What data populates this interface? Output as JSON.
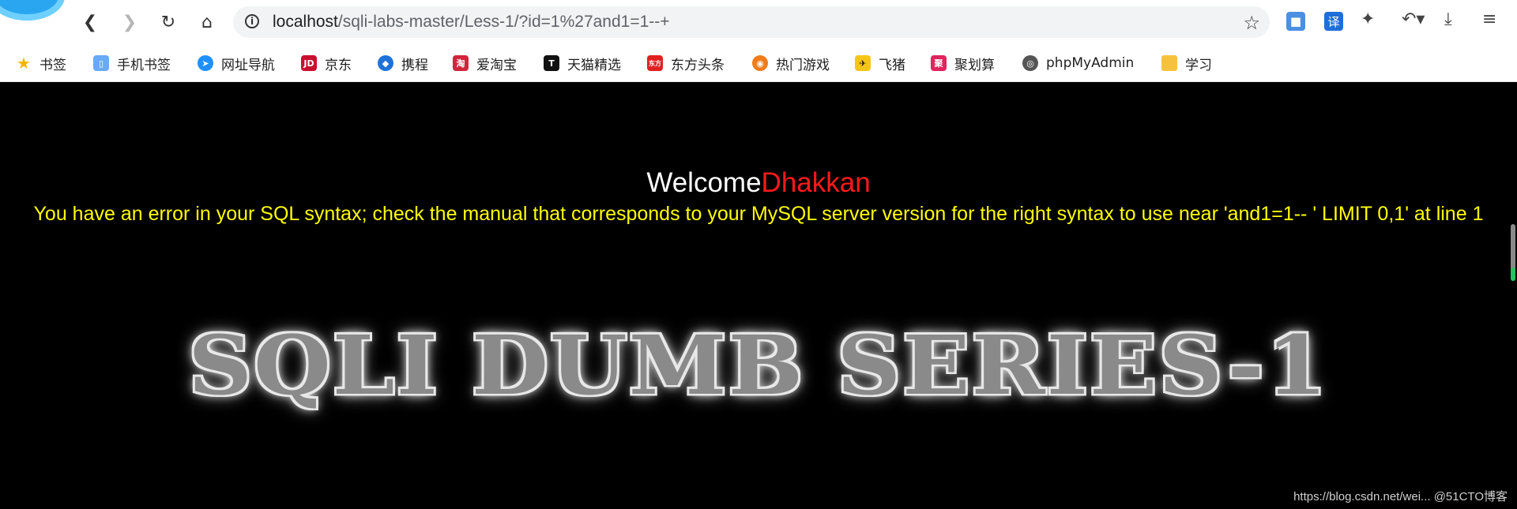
{
  "browser": {
    "url_host": "localhost",
    "url_path": "/sqli-labs-master/Less-1/?id=1%27and1=1--+",
    "icons": [
      "back-icon",
      "forward-icon",
      "reload-icon",
      "home-icon",
      "info-icon",
      "star-icon",
      "extension-icon",
      "undo-icon",
      "download-icon",
      "menu-icon"
    ],
    "ext_translate": "译"
  },
  "bookmarks": [
    {
      "label": "书签",
      "icon": "star-icon",
      "color": "#f5b400",
      "glyph": "★"
    },
    {
      "label": "手机书签",
      "icon": "phone-icon",
      "color": "#3b82f6",
      "glyph": "▯"
    },
    {
      "label": "网址导航",
      "icon": "nav-icon",
      "color": "#1e90ff",
      "glyph": "➤"
    },
    {
      "label": "京东",
      "icon": "jd-icon",
      "color": "#c8102e",
      "glyph": "JD"
    },
    {
      "label": "携程",
      "icon": "ctrip-icon",
      "color": "#1e73d8",
      "glyph": "◆"
    },
    {
      "label": "爱淘宝",
      "icon": "taobao-icon",
      "color": "#d0263c",
      "glyph": "淘"
    },
    {
      "label": "天猫精选",
      "icon": "tmall-icon",
      "color": "#111111",
      "glyph": "T"
    },
    {
      "label": "东方头条",
      "icon": "dftt-icon",
      "color": "#e02020",
      "glyph": "东方"
    },
    {
      "label": "热门游戏",
      "icon": "game-icon",
      "color": "#f07c1a",
      "glyph": "◉"
    },
    {
      "label": "飞猪",
      "icon": "fliggy-icon",
      "color": "#f5c518",
      "glyph": "✈"
    },
    {
      "label": "聚划算",
      "icon": "juhuasuan-icon",
      "color": "#e0245e",
      "glyph": "聚"
    },
    {
      "label": "phpMyAdmin",
      "icon": "phpmyadmin-icon",
      "color": "#555555",
      "glyph": "◎"
    },
    {
      "label": "学习",
      "icon": "folder-icon",
      "color": "#f6c23e",
      "glyph": "▬"
    }
  ],
  "page": {
    "welcome_text": "Welcome",
    "welcome_name": "Dhakkan",
    "error_message": "You have an error in your SQL syntax; check the manual that corresponds to your MySQL server version for the right syntax to use near 'and1=1-- ' LIMIT 0,1' at line 1",
    "banner_text": "SQLI DUMB SERIES-1",
    "watermark": "https://blog.csdn.net/wei... @51CTO博客"
  }
}
